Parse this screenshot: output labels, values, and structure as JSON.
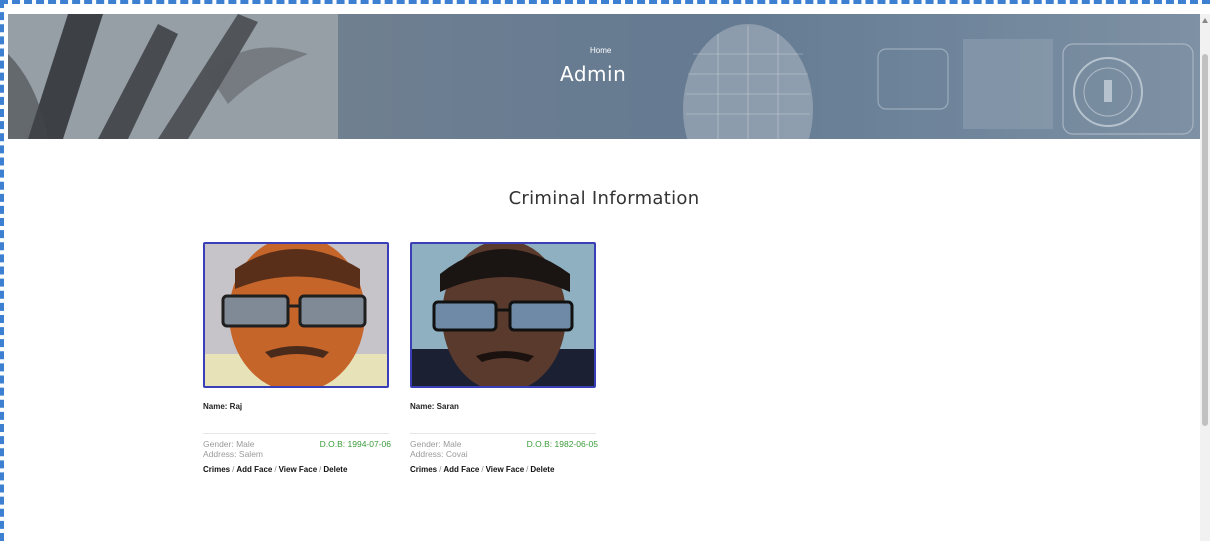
{
  "hero": {
    "breadcrumb": "Home",
    "title": "Admin"
  },
  "section_title": "Criminal Information",
  "criminals": [
    {
      "name": "Name: Raj",
      "gender": "Gender: Male",
      "dob": "D.O.B: 1994-07-06",
      "address": "Address: Salem",
      "actions": {
        "crimes": "Crimes",
        "add_face": "Add Face",
        "view_face": "View Face",
        "delete": "Delete"
      }
    },
    {
      "name": "Name: Saran",
      "gender": "Gender: Male",
      "dob": "D.O.B: 1982-06-05",
      "address": "Address: Covai",
      "actions": {
        "crimes": "Crimes",
        "add_face": "Add Face",
        "view_face": "View Face",
        "delete": "Delete"
      }
    }
  ],
  "separator": "/",
  "colors": {
    "photo_border": "#3a3fb7",
    "dob_green": "#3a9a3a",
    "muted_text": "#9a9a9a"
  }
}
